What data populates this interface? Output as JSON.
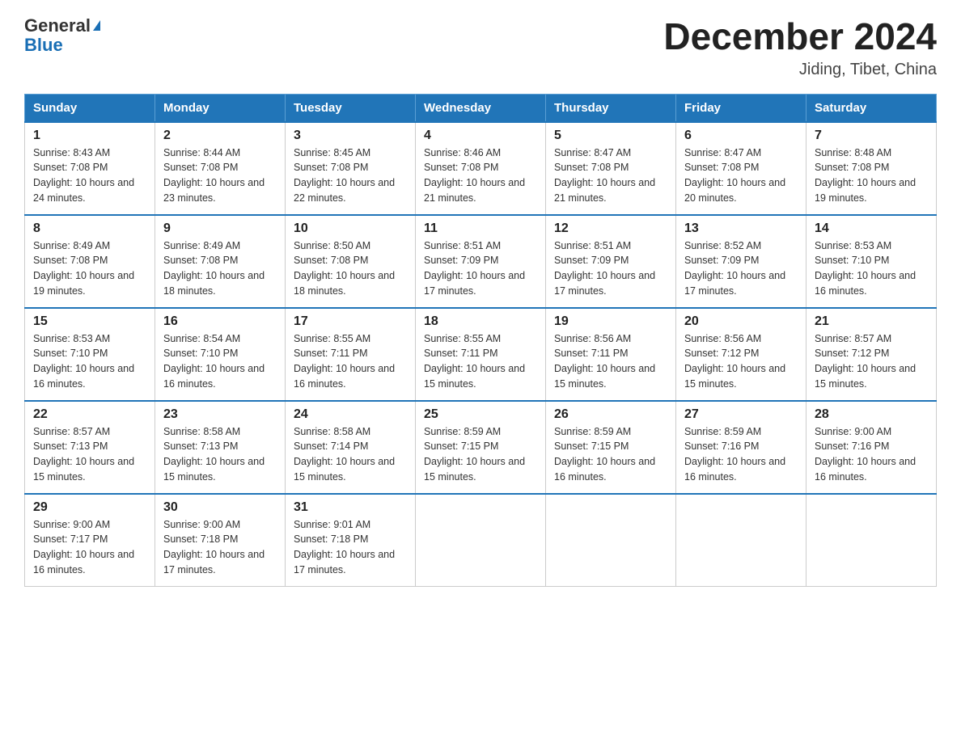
{
  "header": {
    "logo_general": "General",
    "logo_triangle": "▶",
    "logo_blue": "Blue",
    "month_title": "December 2024",
    "location": "Jiding, Tibet, China"
  },
  "weekdays": [
    "Sunday",
    "Monday",
    "Tuesday",
    "Wednesday",
    "Thursday",
    "Friday",
    "Saturday"
  ],
  "weeks": [
    [
      {
        "day": "1",
        "sunrise": "8:43 AM",
        "sunset": "7:08 PM",
        "daylight": "10 hours and 24 minutes."
      },
      {
        "day": "2",
        "sunrise": "8:44 AM",
        "sunset": "7:08 PM",
        "daylight": "10 hours and 23 minutes."
      },
      {
        "day": "3",
        "sunrise": "8:45 AM",
        "sunset": "7:08 PM",
        "daylight": "10 hours and 22 minutes."
      },
      {
        "day": "4",
        "sunrise": "8:46 AM",
        "sunset": "7:08 PM",
        "daylight": "10 hours and 21 minutes."
      },
      {
        "day": "5",
        "sunrise": "8:47 AM",
        "sunset": "7:08 PM",
        "daylight": "10 hours and 21 minutes."
      },
      {
        "day": "6",
        "sunrise": "8:47 AM",
        "sunset": "7:08 PM",
        "daylight": "10 hours and 20 minutes."
      },
      {
        "day": "7",
        "sunrise": "8:48 AM",
        "sunset": "7:08 PM",
        "daylight": "10 hours and 19 minutes."
      }
    ],
    [
      {
        "day": "8",
        "sunrise": "8:49 AM",
        "sunset": "7:08 PM",
        "daylight": "10 hours and 19 minutes."
      },
      {
        "day": "9",
        "sunrise": "8:49 AM",
        "sunset": "7:08 PM",
        "daylight": "10 hours and 18 minutes."
      },
      {
        "day": "10",
        "sunrise": "8:50 AM",
        "sunset": "7:08 PM",
        "daylight": "10 hours and 18 minutes."
      },
      {
        "day": "11",
        "sunrise": "8:51 AM",
        "sunset": "7:09 PM",
        "daylight": "10 hours and 17 minutes."
      },
      {
        "day": "12",
        "sunrise": "8:51 AM",
        "sunset": "7:09 PM",
        "daylight": "10 hours and 17 minutes."
      },
      {
        "day": "13",
        "sunrise": "8:52 AM",
        "sunset": "7:09 PM",
        "daylight": "10 hours and 17 minutes."
      },
      {
        "day": "14",
        "sunrise": "8:53 AM",
        "sunset": "7:10 PM",
        "daylight": "10 hours and 16 minutes."
      }
    ],
    [
      {
        "day": "15",
        "sunrise": "8:53 AM",
        "sunset": "7:10 PM",
        "daylight": "10 hours and 16 minutes."
      },
      {
        "day": "16",
        "sunrise": "8:54 AM",
        "sunset": "7:10 PM",
        "daylight": "10 hours and 16 minutes."
      },
      {
        "day": "17",
        "sunrise": "8:55 AM",
        "sunset": "7:11 PM",
        "daylight": "10 hours and 16 minutes."
      },
      {
        "day": "18",
        "sunrise": "8:55 AM",
        "sunset": "7:11 PM",
        "daylight": "10 hours and 15 minutes."
      },
      {
        "day": "19",
        "sunrise": "8:56 AM",
        "sunset": "7:11 PM",
        "daylight": "10 hours and 15 minutes."
      },
      {
        "day": "20",
        "sunrise": "8:56 AM",
        "sunset": "7:12 PM",
        "daylight": "10 hours and 15 minutes."
      },
      {
        "day": "21",
        "sunrise": "8:57 AM",
        "sunset": "7:12 PM",
        "daylight": "10 hours and 15 minutes."
      }
    ],
    [
      {
        "day": "22",
        "sunrise": "8:57 AM",
        "sunset": "7:13 PM",
        "daylight": "10 hours and 15 minutes."
      },
      {
        "day": "23",
        "sunrise": "8:58 AM",
        "sunset": "7:13 PM",
        "daylight": "10 hours and 15 minutes."
      },
      {
        "day": "24",
        "sunrise": "8:58 AM",
        "sunset": "7:14 PM",
        "daylight": "10 hours and 15 minutes."
      },
      {
        "day": "25",
        "sunrise": "8:59 AM",
        "sunset": "7:15 PM",
        "daylight": "10 hours and 15 minutes."
      },
      {
        "day": "26",
        "sunrise": "8:59 AM",
        "sunset": "7:15 PM",
        "daylight": "10 hours and 16 minutes."
      },
      {
        "day": "27",
        "sunrise": "8:59 AM",
        "sunset": "7:16 PM",
        "daylight": "10 hours and 16 minutes."
      },
      {
        "day": "28",
        "sunrise": "9:00 AM",
        "sunset": "7:16 PM",
        "daylight": "10 hours and 16 minutes."
      }
    ],
    [
      {
        "day": "29",
        "sunrise": "9:00 AM",
        "sunset": "7:17 PM",
        "daylight": "10 hours and 16 minutes."
      },
      {
        "day": "30",
        "sunrise": "9:00 AM",
        "sunset": "7:18 PM",
        "daylight": "10 hours and 17 minutes."
      },
      {
        "day": "31",
        "sunrise": "9:01 AM",
        "sunset": "7:18 PM",
        "daylight": "10 hours and 17 minutes."
      },
      null,
      null,
      null,
      null
    ]
  ]
}
